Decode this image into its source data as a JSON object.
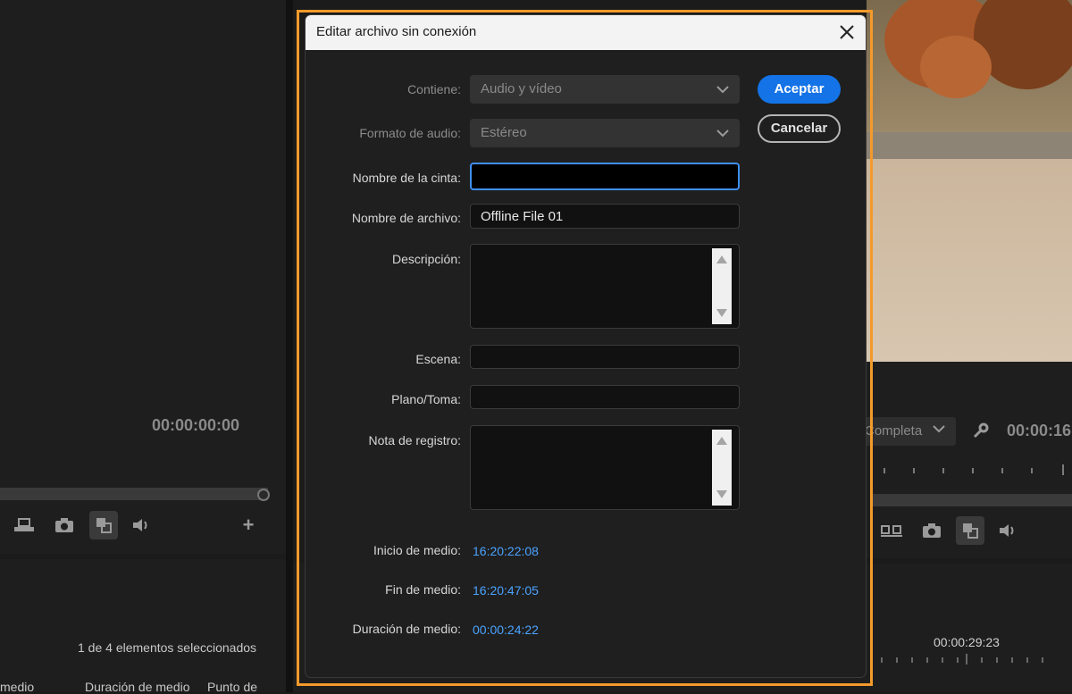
{
  "background": {
    "left_timecode": "00:00:00:00",
    "selection_status": "1 de 4 elementos seleccionados",
    "columns": [
      "medio",
      "Duración de medio",
      "Punto de"
    ],
    "quality": "Completa",
    "right_timecode": "00:00:16",
    "bottom_timecode": "00:00:29:23"
  },
  "dialog": {
    "title": "Editar archivo sin conexión",
    "close_icon": "close-icon",
    "fields": {
      "contiene_label": "Contiene:",
      "contiene_value": "Audio y vídeo",
      "formato_label": "Formato de audio:",
      "formato_value": "Estéreo",
      "cinta_label": "Nombre de la cinta:",
      "cinta_value": "",
      "archivo_label": "Nombre de archivo:",
      "archivo_value": "Offline File 01",
      "descripcion_label": "Descripción:",
      "descripcion_value": "",
      "escena_label": "Escena:",
      "escena_value": "",
      "plano_label": "Plano/Toma:",
      "plano_value": "",
      "nota_label": "Nota de registro:",
      "nota_value": ""
    },
    "timecodes": {
      "inicio_label": "Inicio de medio:",
      "inicio_value": "16:20:22:08",
      "fin_label": "Fin de medio:",
      "fin_value": "16:20:47:05",
      "duracion_label": "Duración de medio:",
      "duracion_value": "00:00:24:22"
    },
    "buttons": {
      "ok": "Aceptar",
      "cancel": "Cancelar"
    }
  },
  "colors": {
    "accent": "#1473e6",
    "timecode": "#4aa3ff",
    "highlight_frame": "#f39a2b"
  }
}
